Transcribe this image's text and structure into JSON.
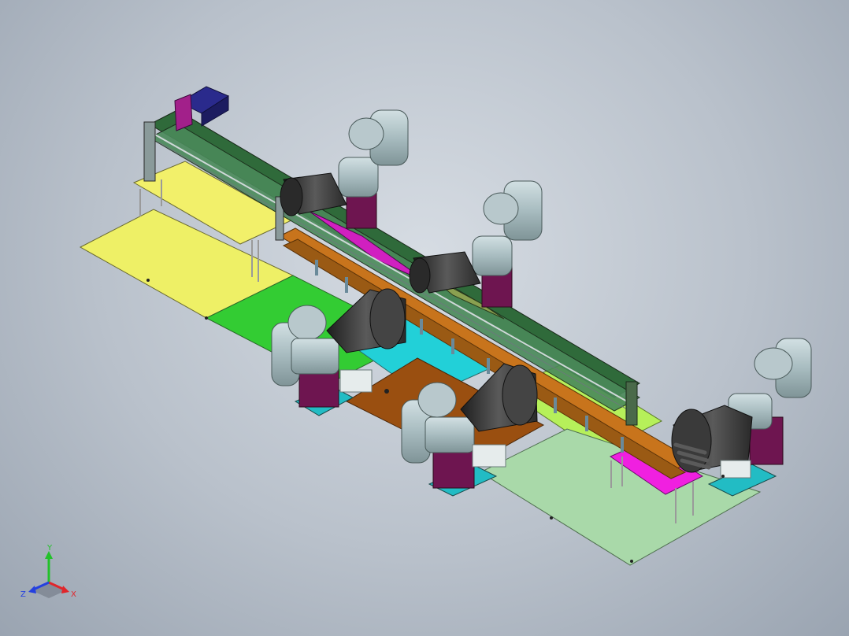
{
  "app": {
    "view": "isometric-3d-assembly"
  },
  "triad": {
    "x_label": "X",
    "y_label": "Y",
    "z_label": "Z",
    "colors": {
      "x": "#e0262b",
      "y": "#22c12a",
      "z": "#2440e0"
    }
  },
  "colors": {
    "background_center": "#d6dce3",
    "background_edge": "#9aa4b1",
    "plate_yellow": "#eef066",
    "plate_green": "#33cc33",
    "plate_cyan": "#22d0d8",
    "plate_brown": "#9a4f10",
    "plate_lightgreen": "#a9d9a9",
    "plate_lime": "#b6f05a",
    "plate_magenta": "#f020e0",
    "robot_gray": "#a8bcc0",
    "robot_purple": "#6e1550",
    "nozzle_dark": "#3a3a3a",
    "rail_orange": "#c8741c",
    "motor_blue": "#2a2a8c"
  }
}
